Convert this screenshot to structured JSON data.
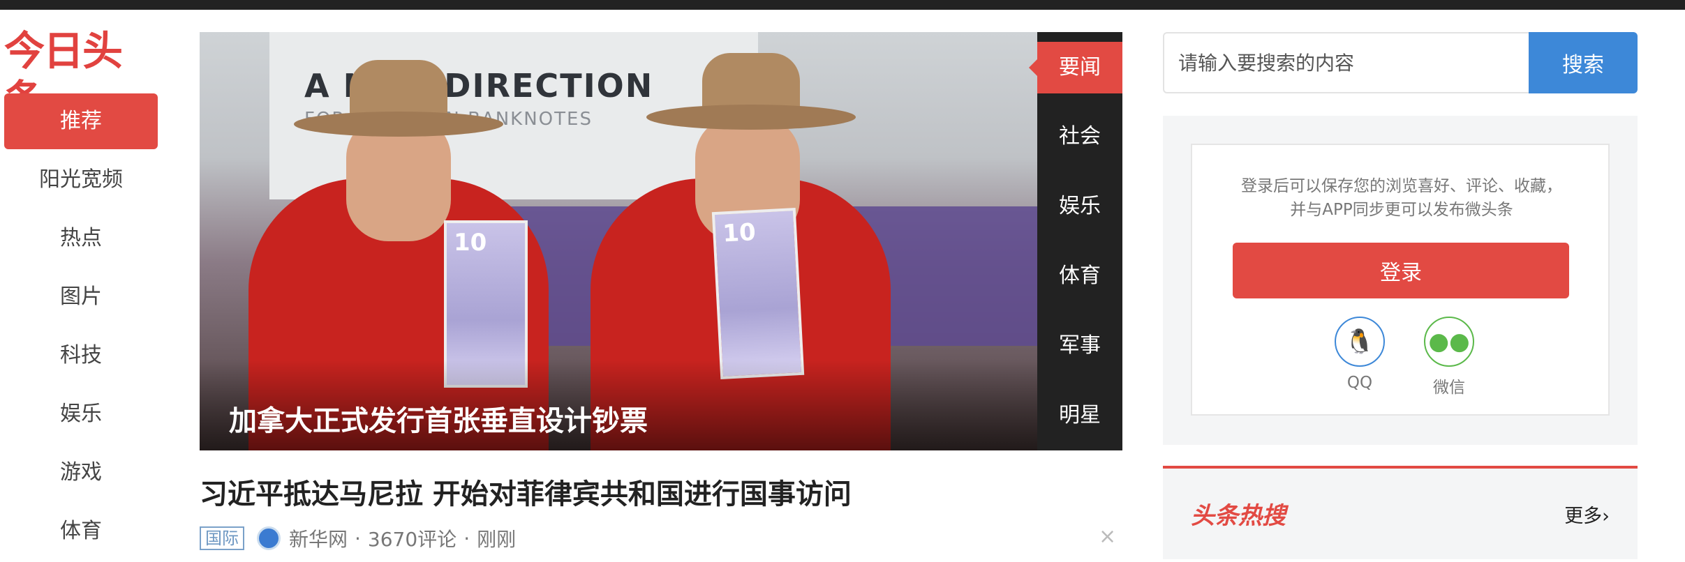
{
  "logo": {
    "text": "今日头条"
  },
  "nav": {
    "items": [
      {
        "label": "推荐",
        "active": true
      },
      {
        "label": "阳光宽频"
      },
      {
        "label": "热点"
      },
      {
        "label": "图片"
      },
      {
        "label": "科技"
      },
      {
        "label": "娱乐"
      },
      {
        "label": "游戏"
      },
      {
        "label": "体育"
      }
    ]
  },
  "hero": {
    "caption": "加拿大正式发行首张垂直设计钞票",
    "image_text": {
      "banner": "A NEW DIRECTION",
      "banner_sub": "FOR CANADIAN BANKNOTES",
      "note_value": "10"
    },
    "categories": [
      "要闻",
      "社会",
      "娱乐",
      "体育",
      "军事",
      "明星"
    ]
  },
  "article": {
    "headline": "习近平抵达马尼拉 开始对菲律宾共和国进行国事访问",
    "tag": "国际",
    "source": "新华网",
    "comments": "3670评论",
    "time": "刚刚",
    "separator": "·",
    "close": "×"
  },
  "search": {
    "placeholder": "请输入要搜索的内容",
    "button": "搜索"
  },
  "login": {
    "tip_line1": "登录后可以保存您的浏览喜好、评论、收藏，",
    "tip_line2": "并与APP同步更可以发布微头条",
    "button": "登录",
    "social": [
      {
        "label": "QQ",
        "icon": "qq-icon"
      },
      {
        "label": "微信",
        "icon": "wechat-icon"
      }
    ]
  },
  "hot": {
    "title": "头条热搜",
    "more": "更多›"
  },
  "colors": {
    "brand_red": "#e24a43",
    "search_blue": "#3d88d8",
    "wechat_green": "#5bb94a"
  }
}
